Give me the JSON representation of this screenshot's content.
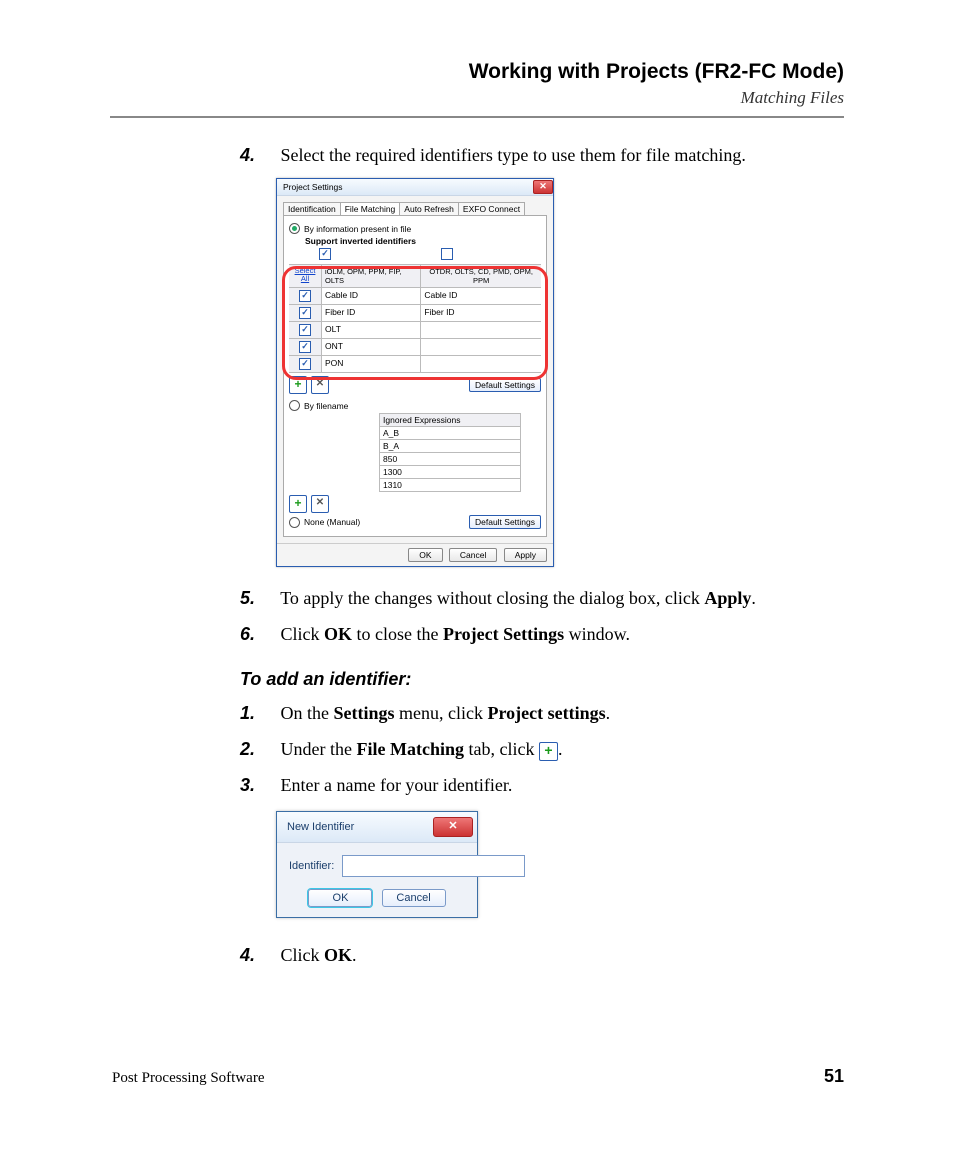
{
  "header": {
    "chapter": "Working with Projects (FR2-FC Mode)",
    "section": "Matching Files"
  },
  "steps_a": {
    "s4": "Select the required identifiers type to use them for file matching.",
    "s5_pre": "To apply the changes without closing the dialog box, click ",
    "s5_bold": "Apply",
    "s6_pre": "Click ",
    "s6_b1": "OK",
    "s6_mid": " to close the ",
    "s6_b2": "Project Settings",
    "s6_post": " window."
  },
  "subhead": "To add an identifier:",
  "steps_b": {
    "s1_pre": "On the ",
    "s1_b1": "Settings",
    "s1_mid": " menu, click ",
    "s1_b2": "Project settings",
    "s2_pre": "Under the ",
    "s2_b1": "File Matching",
    "s2_mid": " tab, click ",
    "s3": "Enter a name for your identifier.",
    "s4_pre": "Click ",
    "s4_b1": "OK"
  },
  "dialog1": {
    "title": "Project Settings",
    "tabs": [
      "Identification",
      "File Matching",
      "Auto Refresh",
      "EXFO Connect"
    ],
    "radio_info": "By information present in file",
    "support_inv": "Support inverted identifiers",
    "select_all_top": "Select",
    "select_all_bot": "All",
    "col1": "iOLM, OPM, PPM, FIP, OLTS",
    "col2": "OTDR, OLTS, CD, PMD, OPM, PPM",
    "rows": [
      {
        "c1": "Cable ID",
        "c2": "Cable ID"
      },
      {
        "c1": "Fiber ID",
        "c2": "Fiber ID"
      },
      {
        "c1": "OLT",
        "c2": ""
      },
      {
        "c1": "ONT",
        "c2": ""
      },
      {
        "c1": "PON",
        "c2": ""
      }
    ],
    "default_settings": "Default Settings",
    "radio_filename": "By filename",
    "ig_header": "Ignored Expressions",
    "ig_rows": [
      "A_B",
      "B_A",
      "850",
      "1300",
      "1310"
    ],
    "radio_none": "None (Manual)",
    "ok": "OK",
    "cancel": "Cancel",
    "apply": "Apply"
  },
  "dialog2": {
    "title": "New Identifier",
    "label": "Identifier:",
    "ok": "OK",
    "cancel": "Cancel"
  },
  "footer": {
    "left": "Post Processing Software",
    "page": "51"
  }
}
